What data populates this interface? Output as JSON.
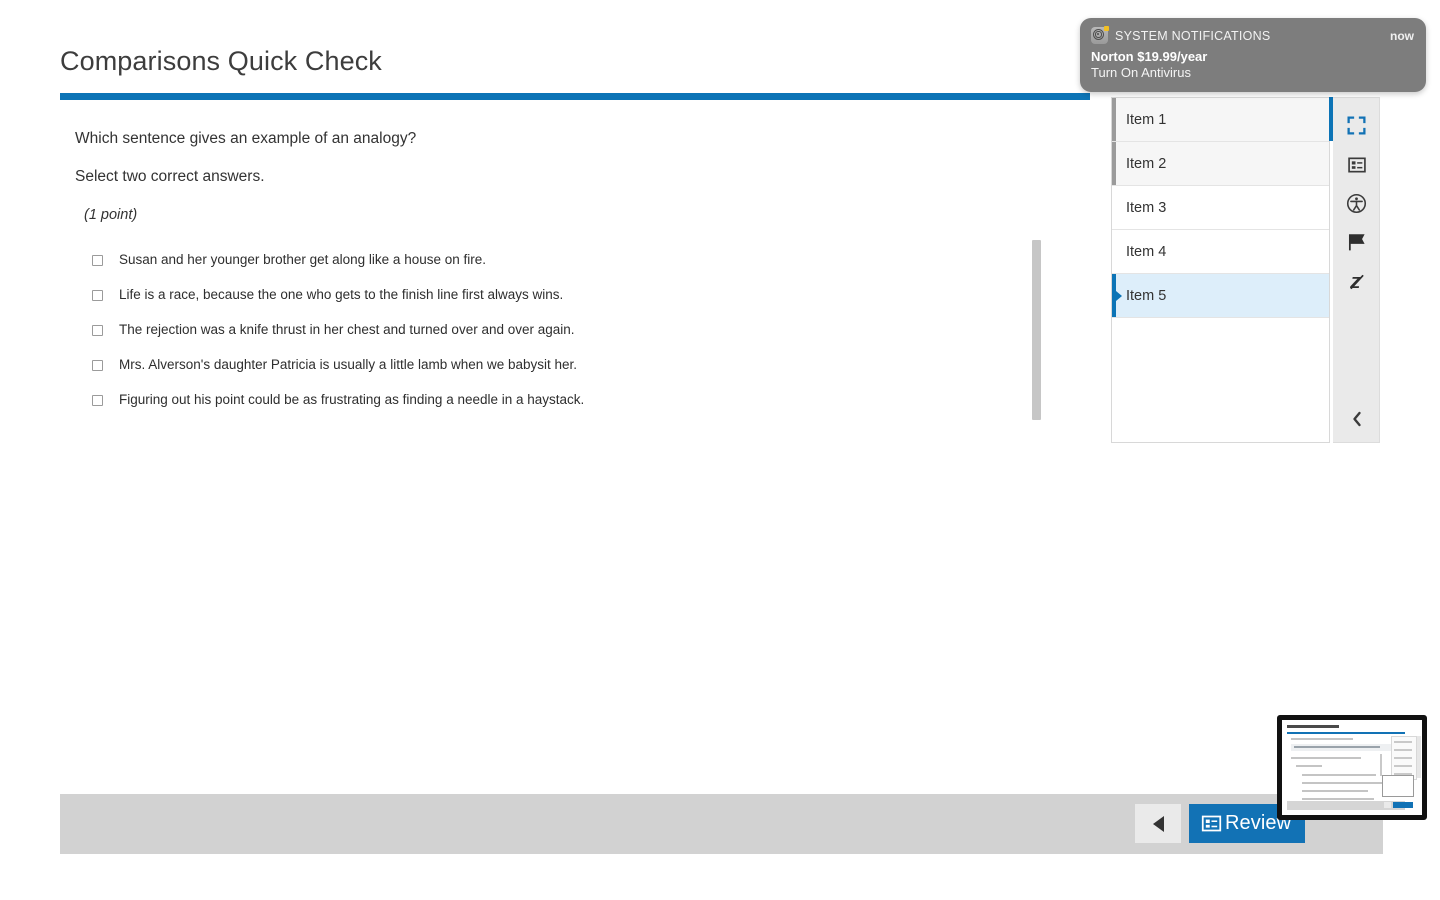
{
  "assessment": {
    "title": "Comparisons Quick Check",
    "question": {
      "prompt": "Which sentence gives an example of an analogy?",
      "instruction": "Select two correct answers.",
      "points": "(1 point)",
      "options": [
        {
          "text": "Susan and her younger brother get along like a house on fire.",
          "checked": false
        },
        {
          "text": "Life is a race, because the one who gets to the finish line first always wins.",
          "checked": false
        },
        {
          "text": "The rejection was a knife thrust in her chest and turned over and over again.",
          "checked": false
        },
        {
          "text": "Mrs. Alverson's daughter Patricia is usually a little lamb when we babysit her.",
          "checked": false
        },
        {
          "text": "Figuring out his point could be as frustrating as finding a needle in a haystack.",
          "checked": false
        }
      ]
    },
    "accent_color": "#0c74b6"
  },
  "footer": {
    "previous_label": "",
    "review_label": "Review"
  },
  "navigator": {
    "items": [
      {
        "label": "Item 1",
        "state": "visited"
      },
      {
        "label": "Item 2",
        "state": "visited"
      },
      {
        "label": "Item 3",
        "state": "plain"
      },
      {
        "label": "Item 4",
        "state": "plain"
      },
      {
        "label": "Item 5",
        "state": "current"
      }
    ]
  },
  "toolbar": {
    "tools": [
      {
        "name": "fullscreen-icon",
        "label": "Full Screen"
      },
      {
        "name": "review-list-icon",
        "label": "Review"
      },
      {
        "name": "accessibility-icon",
        "label": "Accessibility"
      },
      {
        "name": "flag-icon",
        "label": "Flag"
      },
      {
        "name": "line-reader-off-icon",
        "label": "Line Reader"
      }
    ],
    "collapse_label": ""
  },
  "notification": {
    "app": "SYSTEM NOTIFICATIONS",
    "time": "now",
    "title": "Norton $19.99/year",
    "body": "Turn On Antivirus",
    "background": "#7d7d7d"
  }
}
